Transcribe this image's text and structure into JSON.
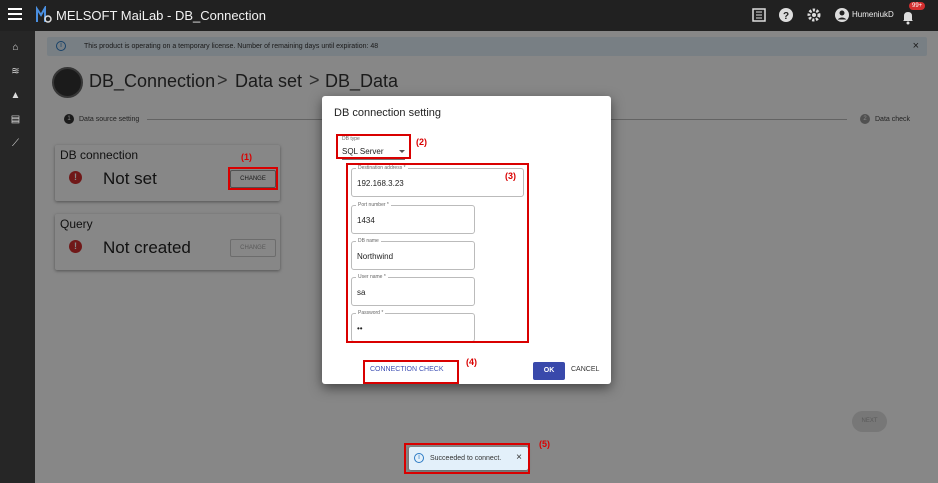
{
  "app": {
    "title": "MELSOFT MaiLab - DB_Connection",
    "user_name": "HumeniukD",
    "notification_count": "99+"
  },
  "license_notice": "This product is operating on a temporary license. Number of remaining days until expiration: 48",
  "breadcrumb": [
    "DB_Connection",
    "Data set",
    "DB_Data"
  ],
  "breadcrumb_separator": ">",
  "stepper": [
    {
      "number": "1",
      "label": "Data source setting"
    },
    {
      "number": "2",
      "label": "Data check"
    }
  ],
  "cards": {
    "db_connection": {
      "title": "DB connection",
      "status": "Not set",
      "button": "CHANGE"
    },
    "query": {
      "title": "Query",
      "status": "Not created",
      "button": "CHANGE"
    }
  },
  "next_label": "NEXT",
  "dialog": {
    "title": "DB connection setting",
    "db_type": {
      "label": "DB type",
      "value": "SQL Server"
    },
    "fields": {
      "destination_address": {
        "label": "Destination address *",
        "value": "192.168.3.23"
      },
      "port_number": {
        "label": "Port number *",
        "value": "1434"
      },
      "db_name": {
        "label": "DB name",
        "value": "Northwind"
      },
      "user_name": {
        "label": "User name *",
        "value": "sa"
      },
      "password": {
        "label": "Password *",
        "value": "••"
      }
    },
    "connection_check": "CONNECTION CHECK",
    "ok": "OK",
    "cancel": "CANCEL"
  },
  "snackbar": {
    "message": "Succeeded to connect."
  },
  "annotations": [
    "(1)",
    "(2)",
    "(3)",
    "(4)",
    "(5)"
  ],
  "colors": {
    "topbar": "#212121",
    "accent": "#3949ab",
    "annotation": "#d90000",
    "error": "#d32f2f",
    "info_bg": "#e3f0fa"
  }
}
